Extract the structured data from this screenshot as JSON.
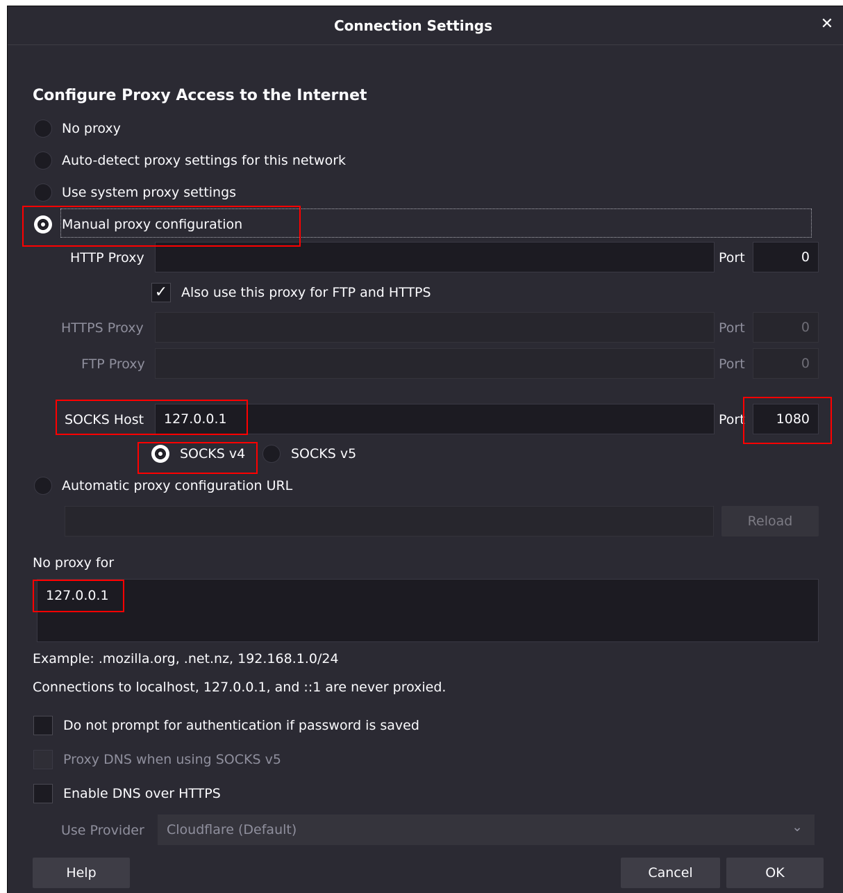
{
  "window": {
    "title": "Connection Settings",
    "close_glyph": "✕"
  },
  "section_title": "Configure Proxy Access to the Internet",
  "proxy_modes": [
    {
      "label": "No proxy",
      "checked": false
    },
    {
      "label": "Auto-detect proxy settings for this network",
      "checked": false
    },
    {
      "label": "Use system proxy settings",
      "checked": false
    },
    {
      "label": "Manual proxy configuration",
      "checked": true
    }
  ],
  "http": {
    "label": "HTTP Proxy",
    "value": "",
    "port_label": "Port",
    "port": "0"
  },
  "also_use": {
    "label": "Also use this proxy for FTP and HTTPS",
    "checked": true,
    "glyph": "✓"
  },
  "https": {
    "label": "HTTPS Proxy",
    "value": "",
    "port_label": "Port",
    "port": "0"
  },
  "ftp": {
    "label": "FTP Proxy",
    "value": "",
    "port_label": "Port",
    "port": "0"
  },
  "socks": {
    "label": "SOCKS Host",
    "value": "127.0.0.1",
    "port_label": "Port",
    "port": "1080",
    "v4_label": "SOCKS v4",
    "v5_label": "SOCKS v5",
    "selected": "v4"
  },
  "auto_url": {
    "label": "Automatic proxy configuration URL",
    "value": "",
    "reload_label": "Reload"
  },
  "no_proxy": {
    "label": "No proxy for",
    "value": "127.0.0.1",
    "example": "Example: .mozilla.org, .net.nz, 192.168.1.0/24",
    "note": "Connections to localhost, 127.0.0.1, and ::1 are never proxied."
  },
  "options": {
    "no_prompt": {
      "label": "Do not prompt for authentication if password is saved",
      "checked": false
    },
    "proxy_dns": {
      "label": "Proxy DNS when using SOCKS v5",
      "checked": false,
      "disabled": true
    },
    "doh": {
      "label": "Enable DNS over HTTPS",
      "checked": false
    }
  },
  "provider": {
    "label": "Use Provider",
    "value": "Cloudflare (Default)",
    "chevron": "⌄"
  },
  "buttons": {
    "help": "Help",
    "cancel": "Cancel",
    "ok": "OK"
  },
  "colors": {
    "dialog_bg": "#2b2a33",
    "field_bg": "#1c1b22",
    "annotation": "#ff0000"
  }
}
